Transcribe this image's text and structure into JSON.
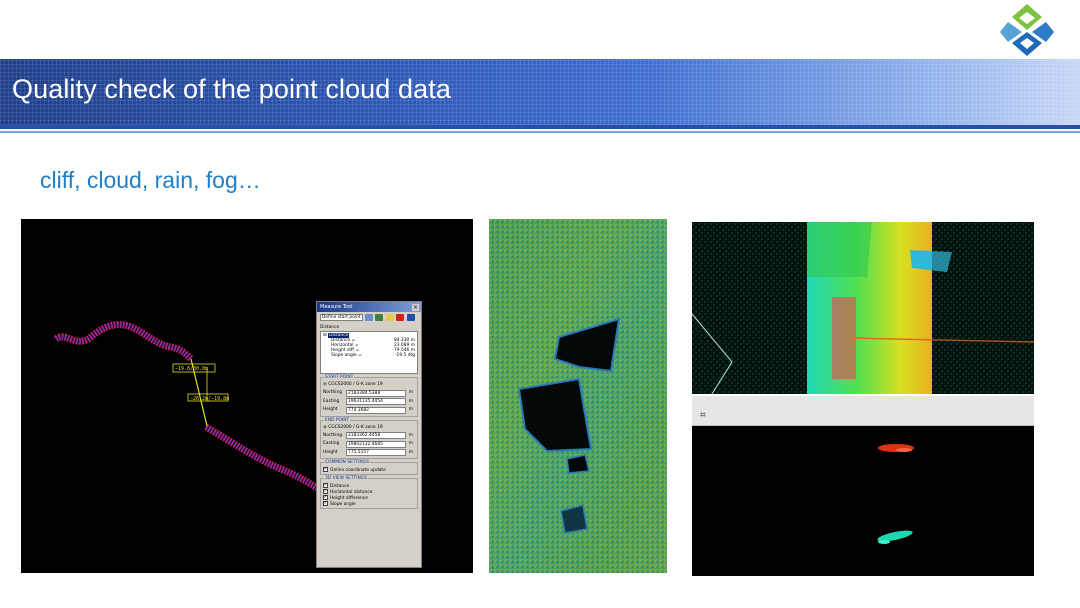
{
  "header": {
    "title": "Quality check of the point cloud data",
    "logo_icon": "company-logo-diamond"
  },
  "subtitle": "cliff, cloud, rain, fog…",
  "colors": {
    "header_dark": "#1f3f8a",
    "header_light": "#c8d8f6",
    "subtitle": "#1f7ec4",
    "logo_green": "#7ec242",
    "logo_blue": "#1f69b6"
  },
  "panels": {
    "cliff": {
      "label_1": "−19.8/30.0m",
      "label_2": "−26.2m/−19.8m",
      "measure_tool": {
        "title": "Measure Tool",
        "mode": "Define start point",
        "list_header": "Distance",
        "distance_item": "Distance",
        "rows": [
          {
            "label": "Distance =",
            "value": "84.330 m"
          },
          {
            "label": "Horizontal =",
            "value": "23.089 m"
          },
          {
            "label": "Height diff =",
            "value": "-79.546 m"
          },
          {
            "label": "Slope angle =",
            "value": "-19.5 dtg"
          }
        ],
        "start_point": {
          "title": "START POINT",
          "system": "CGCS2000 / G-K zone 19",
          "northing": "2183384.5388",
          "easting": "19631135.4454",
          "height": "774.3682",
          "unit": "m"
        },
        "end_point": {
          "title": "END POINT",
          "system": "CGCS2000 / G-K zone 19",
          "northing": "2183362.4458",
          "easting": "19802132.4685",
          "height": "775.5157",
          "unit": "m"
        },
        "common_settings": {
          "title": "COMMON SETTINGS",
          "online_update": "Online coordinate update"
        },
        "view_settings": {
          "title": "3D VIEW SETTINGS",
          "options": [
            "Distance",
            "Horizontal distance",
            "Height difference",
            "Slope angle"
          ]
        },
        "field_labels": {
          "northing": "Northing",
          "easting": "Easting",
          "height": "Height"
        }
      }
    }
  }
}
